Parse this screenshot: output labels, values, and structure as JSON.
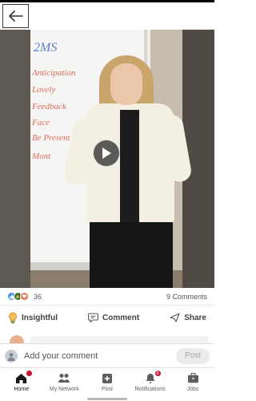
{
  "header": {
    "back_icon": "arrow-left-icon"
  },
  "video": {
    "board_title": "2MS",
    "board_lines": [
      "Anticipation",
      "Lovely",
      "Feedback",
      "Face",
      "Be Present",
      "Mont"
    ],
    "play_icon": "play-icon"
  },
  "social": {
    "reaction_count": "36",
    "comment_count": "9 Comments",
    "reaction_icons": [
      "like-icon",
      "celebrate-icon",
      "love-icon"
    ]
  },
  "actions": {
    "insightful_label": "Insightful",
    "comment_label": "Comment",
    "share_label": "Share"
  },
  "comment_bar": {
    "placeholder": "Add your comment",
    "post_label": "Post"
  },
  "tabs": [
    {
      "label": "Home",
      "icon": "home-icon",
      "badge": "",
      "active": true
    },
    {
      "label": "My Network",
      "icon": "network-icon",
      "badge": ""
    },
    {
      "label": "Post",
      "icon": "plus-box-icon",
      "badge": ""
    },
    {
      "label": "Notifications",
      "icon": "bell-icon",
      "badge": "8"
    },
    {
      "label": "Jobs",
      "icon": "briefcase-icon",
      "badge": ""
    }
  ],
  "colors": {
    "accent": "#0a66c2",
    "badge": "#cb112d",
    "board_ink": "#e26a5a"
  }
}
